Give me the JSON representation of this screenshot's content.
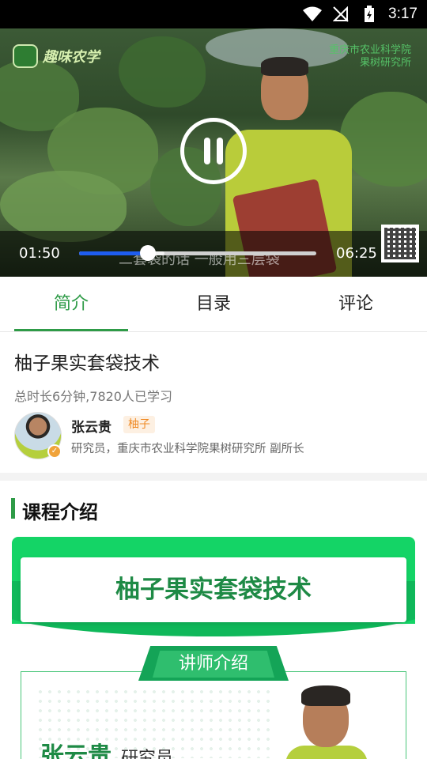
{
  "status_bar": {
    "time": "3:17"
  },
  "video": {
    "logo_left": "趣味农学",
    "logo_right_line1": "重庆市农业科学院",
    "logo_right_line2": "果树研究所",
    "subtitle": "二套袋的话 一般用三层袋",
    "current_time": "01:50",
    "duration": "06:25",
    "progress_played": 0.29,
    "progress_buffered": 0.36
  },
  "tabs": [
    {
      "label": "简介",
      "active": true
    },
    {
      "label": "目录",
      "active": false
    },
    {
      "label": "评论",
      "active": false
    }
  ],
  "course": {
    "title": "柚子果实套袋技术",
    "meta": "总时长6分钟,7820人已学习"
  },
  "teacher": {
    "name": "张云贵",
    "tag": "柚子",
    "description": "研究员，重庆市农业科学院果树研究所 副所长"
  },
  "section": {
    "title": "课程介绍"
  },
  "poster": {
    "title": "柚子果实套袋技术",
    "ribbon": "讲师介绍",
    "name": "张云贵",
    "role": "研究员"
  },
  "colors": {
    "accent": "#2e9b47",
    "progress": "#1e5df0",
    "tag": "#f08a24"
  }
}
